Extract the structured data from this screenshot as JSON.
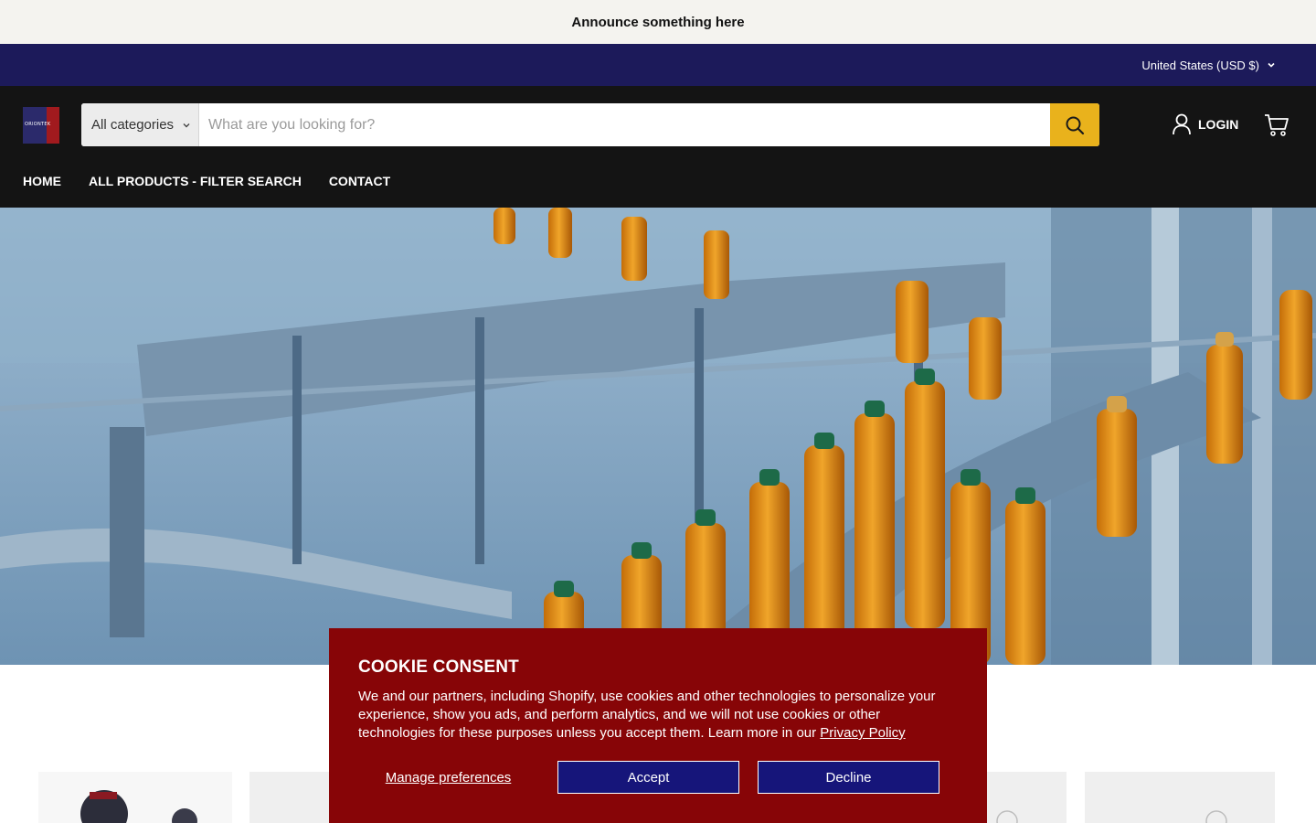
{
  "announcement": "Announce something here",
  "utility_bar": {
    "currency": "United States (USD $)"
  },
  "brand": {
    "logo_text": "ORIONTEK"
  },
  "search": {
    "category": "All categories",
    "placeholder": "What are you looking for?"
  },
  "account": {
    "login_label": "LOGIN"
  },
  "nav": {
    "items": [
      "HOME",
      "ALL PRODUCTS - FILTER SEARCH",
      "CONTACT"
    ]
  },
  "cookie_banner": {
    "title": "COOKIE CONSENT",
    "body": "We and our partners, including Shopify, use cookies and other technologies to personalize your experience, show you ads, and perform analytics, and we will not use cookies or other technologies for these purposes unless you accept them. Learn more in our",
    "link_text": "Privacy Policy",
    "manage_label": "Manage preferences",
    "accept_label": "Accept",
    "decline_label": "Decline"
  },
  "colors": {
    "announcement_bg": "#f4f3ef",
    "utility_bg": "#1c1a5a",
    "header_bg": "#141414",
    "search_button": "#e9b21c",
    "cookie_bg": "#870507",
    "cookie_button": "#16157a"
  },
  "icons": [
    "chevron-down-icon",
    "search-icon",
    "user-icon",
    "cart-icon"
  ]
}
